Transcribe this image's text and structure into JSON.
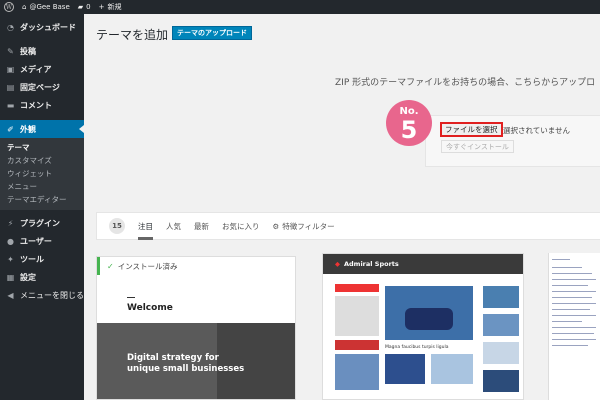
{
  "admin_bar": {
    "site_name": "@Gee Base",
    "comments_count": "0",
    "new_label": "新規"
  },
  "sidebar": {
    "items": [
      {
        "label": "ダッシュボード",
        "icon": "dashboard-icon"
      },
      {
        "label": "投稿",
        "icon": "pin-icon"
      },
      {
        "label": "メディア",
        "icon": "media-icon"
      },
      {
        "label": "固定ページ",
        "icon": "page-icon"
      },
      {
        "label": "コメント",
        "icon": "comment-icon"
      },
      {
        "label": "外観",
        "icon": "brush-icon"
      },
      {
        "label": "プラグイン",
        "icon": "plugin-icon"
      },
      {
        "label": "ユーザー",
        "icon": "user-icon"
      },
      {
        "label": "ツール",
        "icon": "wrench-icon"
      },
      {
        "label": "設定",
        "icon": "settings-icon"
      },
      {
        "label": "メニューを閉じる",
        "icon": "collapse-icon"
      }
    ],
    "submenu": [
      "テーマ",
      "カスタマイズ",
      "ウィジェット",
      "メニュー",
      "テーマエディター"
    ]
  },
  "page": {
    "title": "テーマを追加",
    "upload_button": "テーマのアップロード",
    "zip_text": "ZIP 形式のテーマファイルをお持ちの場合、こちらからアップロ",
    "badge_no": "No.",
    "badge_num": "5",
    "choose_file": "ファイルを選択",
    "not_selected": "選択されていません",
    "install_now": "今すぐインストール"
  },
  "filter_bar": {
    "count": "15",
    "tabs": [
      "注目",
      "人気",
      "最新",
      "お気に入り"
    ],
    "feature_filter": "特徴フィルター"
  },
  "themes": {
    "card1": {
      "installed_label": "インストール済み",
      "welcome": "Welcome",
      "headline": "Digital strategy for\nunique small businesses"
    },
    "card2": {
      "site_title": "Admiral Sports",
      "hero_caption": "Magna faucibus turpis ligula"
    }
  },
  "colors": {
    "admin_bg": "#23282d",
    "accent": "#0073aa",
    "badge": "#e8668d",
    "highlight": "#e02020",
    "installed": "#46b450"
  }
}
